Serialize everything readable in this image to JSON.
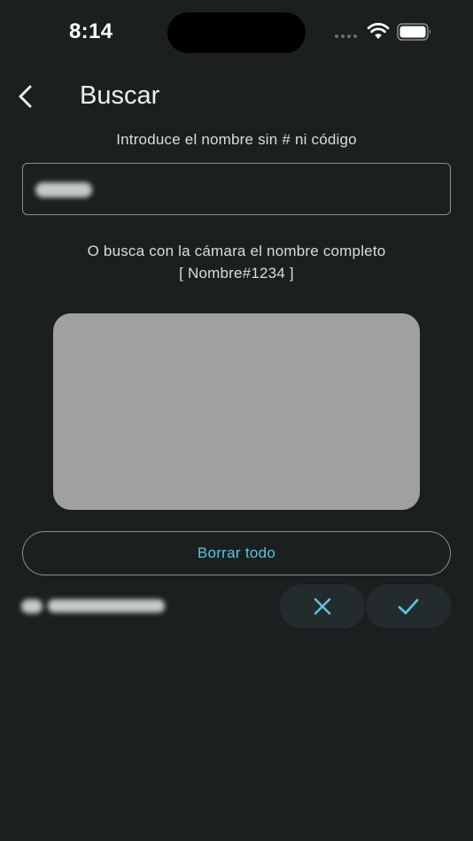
{
  "status_bar": {
    "time": "8:14"
  },
  "header": {
    "title": "Buscar",
    "back_icon": "chevron-left-icon"
  },
  "search": {
    "instruction": "Introduce el nombre sin # ni código",
    "input_value_obscured": true
  },
  "camera": {
    "hint_line1": "O busca con la cámara el nombre completo",
    "hint_line2": "[ Nombre#1234 ]"
  },
  "actions": {
    "clear_label": "Borrar todo",
    "cancel_icon": "close-icon",
    "confirm_icon": "check-icon"
  },
  "colors": {
    "background": "#1b1f20",
    "accent": "#55c6df",
    "camera_placeholder": "#a0a0a0",
    "button_fill": "#242b2d"
  }
}
